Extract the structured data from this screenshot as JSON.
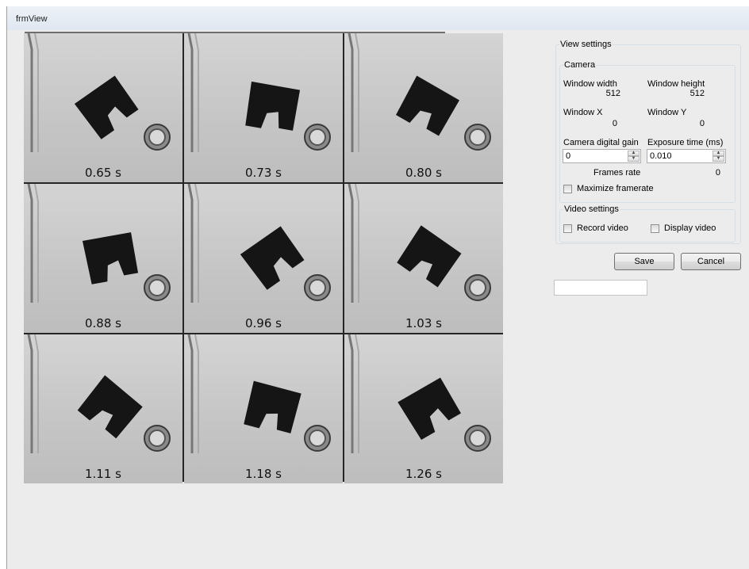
{
  "window": {
    "title": "frmView"
  },
  "frames": [
    {
      "time": "0.65 s"
    },
    {
      "time": "0.73 s"
    },
    {
      "time": "0.80 s"
    },
    {
      "time": "0.88 s"
    },
    {
      "time": "0.96 s"
    },
    {
      "time": "1.03 s"
    },
    {
      "time": "1.11 s"
    },
    {
      "time": "1.18 s"
    },
    {
      "time": "1.26 s"
    }
  ],
  "view_settings": {
    "legend": "View settings",
    "camera": {
      "legend": "Camera",
      "window_width_label": "Window width",
      "window_width_value": "512",
      "window_height_label": "Window height",
      "window_height_value": "512",
      "window_x_label": "Window X",
      "window_x_value": "0",
      "window_y_label": "Window Y",
      "window_y_value": "0",
      "gain_label": "Camera digital gain",
      "gain_value": "0",
      "exposure_label": "Exposure time (ms)",
      "exposure_value": "0.010",
      "frames_rate_label": "Frames rate",
      "frames_rate_value": "0",
      "maximize_label": "Maximize framerate",
      "maximize_checked": false
    },
    "video": {
      "legend": "Video settings",
      "record_label": "Record video",
      "record_checked": false,
      "display_label": "Display video",
      "display_checked": false
    }
  },
  "buttons": {
    "save": "Save",
    "cancel": "Cancel"
  },
  "text_field": {
    "value": ""
  }
}
